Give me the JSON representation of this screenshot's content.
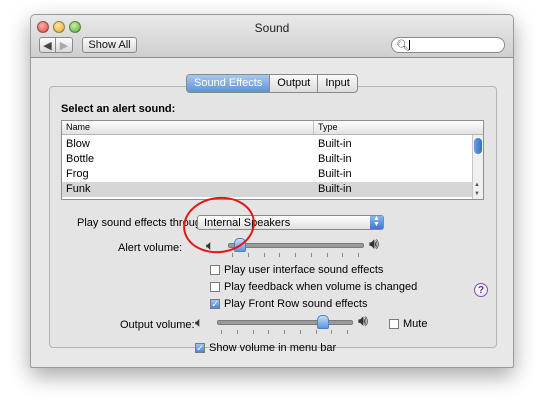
{
  "window": {
    "title": "Sound",
    "nav": {
      "back_label": "◀",
      "forward_label": "▶",
      "show_all_label": "Show All"
    },
    "search": {
      "icon": "magnifier-icon",
      "value": ""
    }
  },
  "tabs": [
    {
      "label": "Sound Effects",
      "active": true
    },
    {
      "label": "Output",
      "active": false
    },
    {
      "label": "Input",
      "active": false
    }
  ],
  "alert_section": {
    "prompt": "Select an alert sound:",
    "columns": [
      "Name",
      "Type"
    ],
    "rows": [
      {
        "name": "Blow",
        "type": "Built-in"
      },
      {
        "name": "Bottle",
        "type": "Built-in"
      },
      {
        "name": "Frog",
        "type": "Built-in"
      },
      {
        "name": "Funk",
        "type": "Built-in",
        "selected": true
      }
    ]
  },
  "play_through": {
    "label": "Play sound effects through:",
    "value": "Internal Speakers"
  },
  "alert_volume": {
    "label": "Alert volume:",
    "level": 0.08
  },
  "checkboxes": [
    {
      "label": "Play user interface sound effects",
      "checked": false
    },
    {
      "label": "Play feedback when volume is changed",
      "checked": false
    },
    {
      "label": "Play Front Row sound effects",
      "checked": true
    }
  ],
  "help_label": "?",
  "output_volume": {
    "label": "Output volume:",
    "level": 0.78
  },
  "mute": {
    "label": "Mute",
    "checked": false
  },
  "menu_bar": {
    "label": "Show volume in menu bar",
    "checked": true
  },
  "colors": {
    "accent": "#4d87d8",
    "annotation": "#e01818"
  }
}
